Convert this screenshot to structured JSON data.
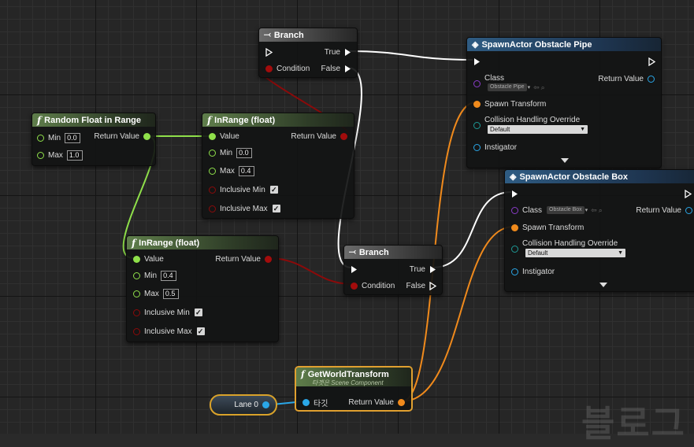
{
  "colors": {
    "exec": "#ffffff",
    "float": "#8fe04a",
    "bool": "#a30c0c",
    "transform": "#f08a1c",
    "object": "#2aa7e8",
    "class": "#8a3cc9"
  },
  "random_float": {
    "title": "Random Float in Range",
    "min_label": "Min",
    "min_value": "0.0",
    "max_label": "Max",
    "max_value": "1.0",
    "return_label": "Return Value"
  },
  "inrange1": {
    "title": "InRange (float)",
    "value_label": "Value",
    "return_label": "Return Value",
    "min_label": "Min",
    "min_value": "0.0",
    "max_label": "Max",
    "max_value": "0.4",
    "incl_min_label": "Inclusive Min",
    "incl_max_label": "Inclusive Max",
    "check": "✓"
  },
  "inrange2": {
    "title": "InRange (float)",
    "value_label": "Value",
    "return_label": "Return Value",
    "min_label": "Min",
    "min_value": "0.4",
    "max_label": "Max",
    "max_value": "0.5",
    "incl_min_label": "Inclusive Min",
    "incl_max_label": "Inclusive Max",
    "check": "✓"
  },
  "branch1": {
    "title": "Branch",
    "true_label": "True",
    "false_label": "False",
    "condition_label": "Condition"
  },
  "branch2": {
    "title": "Branch",
    "true_label": "True",
    "false_label": "False",
    "condition_label": "Condition"
  },
  "spawn_pipe": {
    "title": "SpawnActor Obstacle Pipe",
    "class_label": "Class",
    "class_value": "Obstacle Pipe",
    "return_label": "Return Value",
    "transform_label": "Spawn Transform",
    "collision_label": "Collision Handling Override",
    "collision_value": "Default",
    "instigator_label": "Instigator"
  },
  "spawn_box": {
    "title": "SpawnActor Obstacle Box",
    "class_label": "Class",
    "class_value": "Obstacle Box",
    "return_label": "Return Value",
    "transform_label": "Spawn Transform",
    "collision_label": "Collision Handling Override",
    "collision_value": "Default",
    "instigator_label": "Instigator"
  },
  "get_world_transform": {
    "title": "GetWorldTransform",
    "subtitle": "타겟은 Scene Component",
    "target_label": "타깃",
    "return_label": "Return Value"
  },
  "lane_var": {
    "label": "Lane 0"
  },
  "watermark": {
    "text": "블로그"
  }
}
